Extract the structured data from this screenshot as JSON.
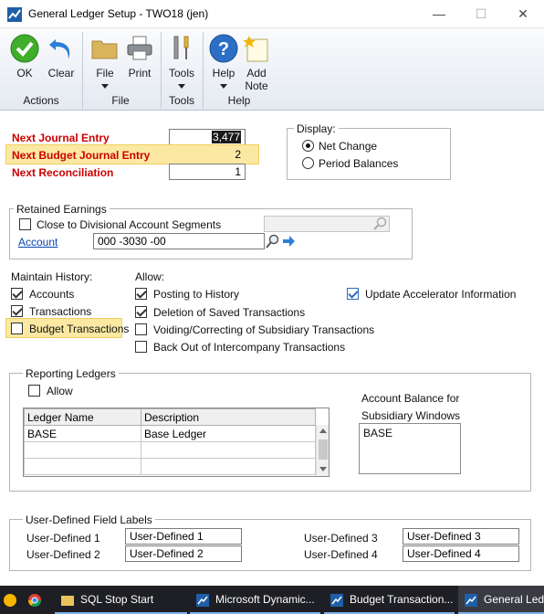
{
  "window": {
    "title": "General Ledger Setup  -  TWO18 (jen)",
    "minimize": "—",
    "maximize": "☐",
    "close": "✕"
  },
  "ribbon": {
    "ok": "OK",
    "clear": "Clear",
    "file": "File",
    "print": "Print",
    "tools": "Tools",
    "help": "Help",
    "add_note_1": "Add",
    "add_note_2": "Note",
    "groups": {
      "actions": "Actions",
      "file": "File",
      "tools": "Tools",
      "help": "Help"
    }
  },
  "next_numbers": {
    "journal_label": "Next Journal Entry",
    "journal_value": "3,477",
    "budget_label": "Next Budget Journal Entry",
    "budget_value": "2",
    "reconciliation_label": "Next Reconciliation",
    "reconciliation_value": "1"
  },
  "display": {
    "legend": "Display:",
    "net_change": "Net Change",
    "period_balances": "Period Balances",
    "selected": "net_change"
  },
  "retained_earnings": {
    "legend": "Retained Earnings",
    "close_divisional": "Close to Divisional Account Segments",
    "account_link": "Account",
    "account_value": "000 -3030 -00"
  },
  "maintain_history": {
    "title": "Maintain History:",
    "accounts": "Accounts",
    "transactions": "Transactions",
    "budget_transactions": "Budget Transactions"
  },
  "allow": {
    "title": "Allow:",
    "posting_to_history": "Posting to History",
    "deletion_saved": "Deletion of Saved Transactions",
    "voiding": "Voiding/Correcting of Subsidiary Transactions",
    "back_out": "Back Out of Intercompany Transactions",
    "update_accelerator": "Update Accelerator Information"
  },
  "reporting_ledgers": {
    "legend": "Reporting Ledgers",
    "allow": "Allow",
    "col_ledger_name": "Ledger Name",
    "col_description": "Description",
    "rows": [
      {
        "ledger_name": "BASE",
        "description": "Base Ledger"
      }
    ],
    "account_balance_label_1": "Account Balance for",
    "account_balance_label_2": "Subsidiary Windows",
    "account_balance_value": "BASE"
  },
  "user_defined": {
    "legend": "User-Defined Field Labels",
    "label1": "User-Defined 1",
    "value1": "User-Defined 1",
    "label2": "User-Defined 2",
    "value2": "User-Defined 2",
    "label3": "User-Defined 3",
    "value3": "User-Defined 3",
    "label4": "User-Defined 4",
    "value4": "User-Defined 4"
  },
  "taskbar": {
    "items": [
      {
        "label": "SQL Stop Start"
      },
      {
        "label": "Microsoft Dynamic..."
      },
      {
        "label": "Budget Transaction..."
      },
      {
        "label": "General Ledg"
      }
    ]
  },
  "colors": {
    "required_label": "#cc0000",
    "highlight": "#fbe9a3",
    "link": "#0645ad",
    "taskbar": "#1e1f24"
  }
}
